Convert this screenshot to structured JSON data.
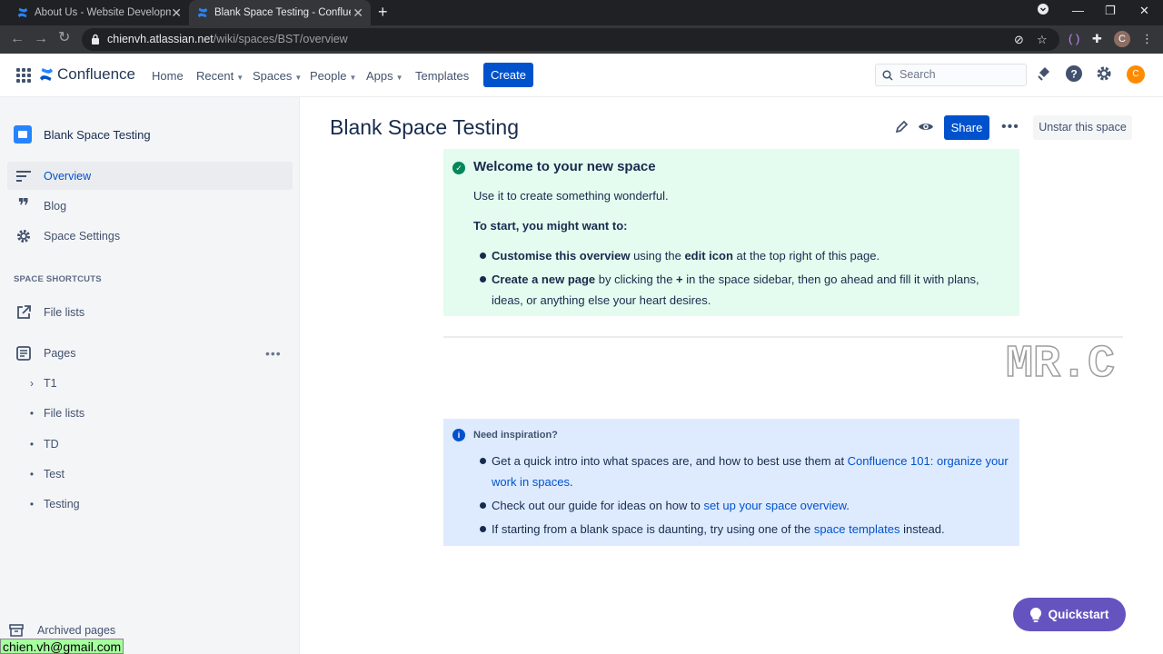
{
  "browser": {
    "tabs": [
      {
        "title": "About Us - Website Development",
        "active": false
      },
      {
        "title": "Blank Space Testing - Confluence",
        "active": true
      }
    ],
    "url_host": "chienvh.atlassian.net",
    "url_path": "/wiki/spaces/BST/overview",
    "profile_initial": "C"
  },
  "topnav": {
    "logo": "Confluence",
    "items": [
      "Home",
      "Recent",
      "Spaces",
      "People",
      "Apps",
      "Templates"
    ],
    "create_label": "Create",
    "search_placeholder": "Search",
    "avatar_initial": "C"
  },
  "sidebar": {
    "space_name": "Blank Space Testing",
    "items": [
      {
        "label": "Overview",
        "icon": "overview-icon",
        "active": true
      },
      {
        "label": "Blog",
        "icon": "quote-icon"
      },
      {
        "label": "Space Settings",
        "icon": "gear-icon"
      }
    ],
    "shortcuts_heading": "SPACE SHORTCUTS",
    "shortcut": "File lists",
    "pages_label": "Pages",
    "tree": [
      {
        "label": "T1",
        "bullet": "›"
      },
      {
        "label": "File lists",
        "bullet": "•"
      },
      {
        "label": "TD",
        "bullet": "•"
      },
      {
        "label": "Test",
        "bullet": "•"
      },
      {
        "label": "Testing",
        "bullet": "•"
      }
    ],
    "archived_label": "Archived pages"
  },
  "status_bar": "chien.vh@gmail.com",
  "main": {
    "title": "Blank Space Testing",
    "share_label": "Share",
    "unstar_label": "Unstar this space",
    "welcome": {
      "title": "Welcome to your new space",
      "intro": "Use it to create something wonderful.",
      "subheading": "To start, you might want to:",
      "b1_bold": "Customise this overview",
      "b1_mid": " using the ",
      "b1_bold2": "edit icon",
      "b1_end": " at the top right of this page.",
      "b2_bold": "Create a new page",
      "b2_mid": " by clicking the ",
      "b2_bold2": "+",
      "b2_end": " in the space sidebar, then go ahead and fill it with plans, ideas, or anything else your heart desires."
    },
    "inspiration": {
      "title": "Need inspiration?",
      "b1_text": "Get a quick intro into what spaces are, and how to best use them at ",
      "b1_link": "Confluence 101: organize your work in spaces",
      "b1_end": ".",
      "b2_text": "Check out our guide for ideas on how to ",
      "b2_link": "set up your space overview",
      "b2_end": ".",
      "b3_text": "If starting from a blank space is daunting, try using one of the ",
      "b3_link": "space templates",
      "b3_end": " instead."
    },
    "watermark": "MR.C",
    "quickstart_label": "Quickstart"
  },
  "colors": {
    "primary": "#0052cc",
    "success_panel": "#e3fcef",
    "info_panel": "#deebff",
    "quickstart": "#6554c0"
  }
}
